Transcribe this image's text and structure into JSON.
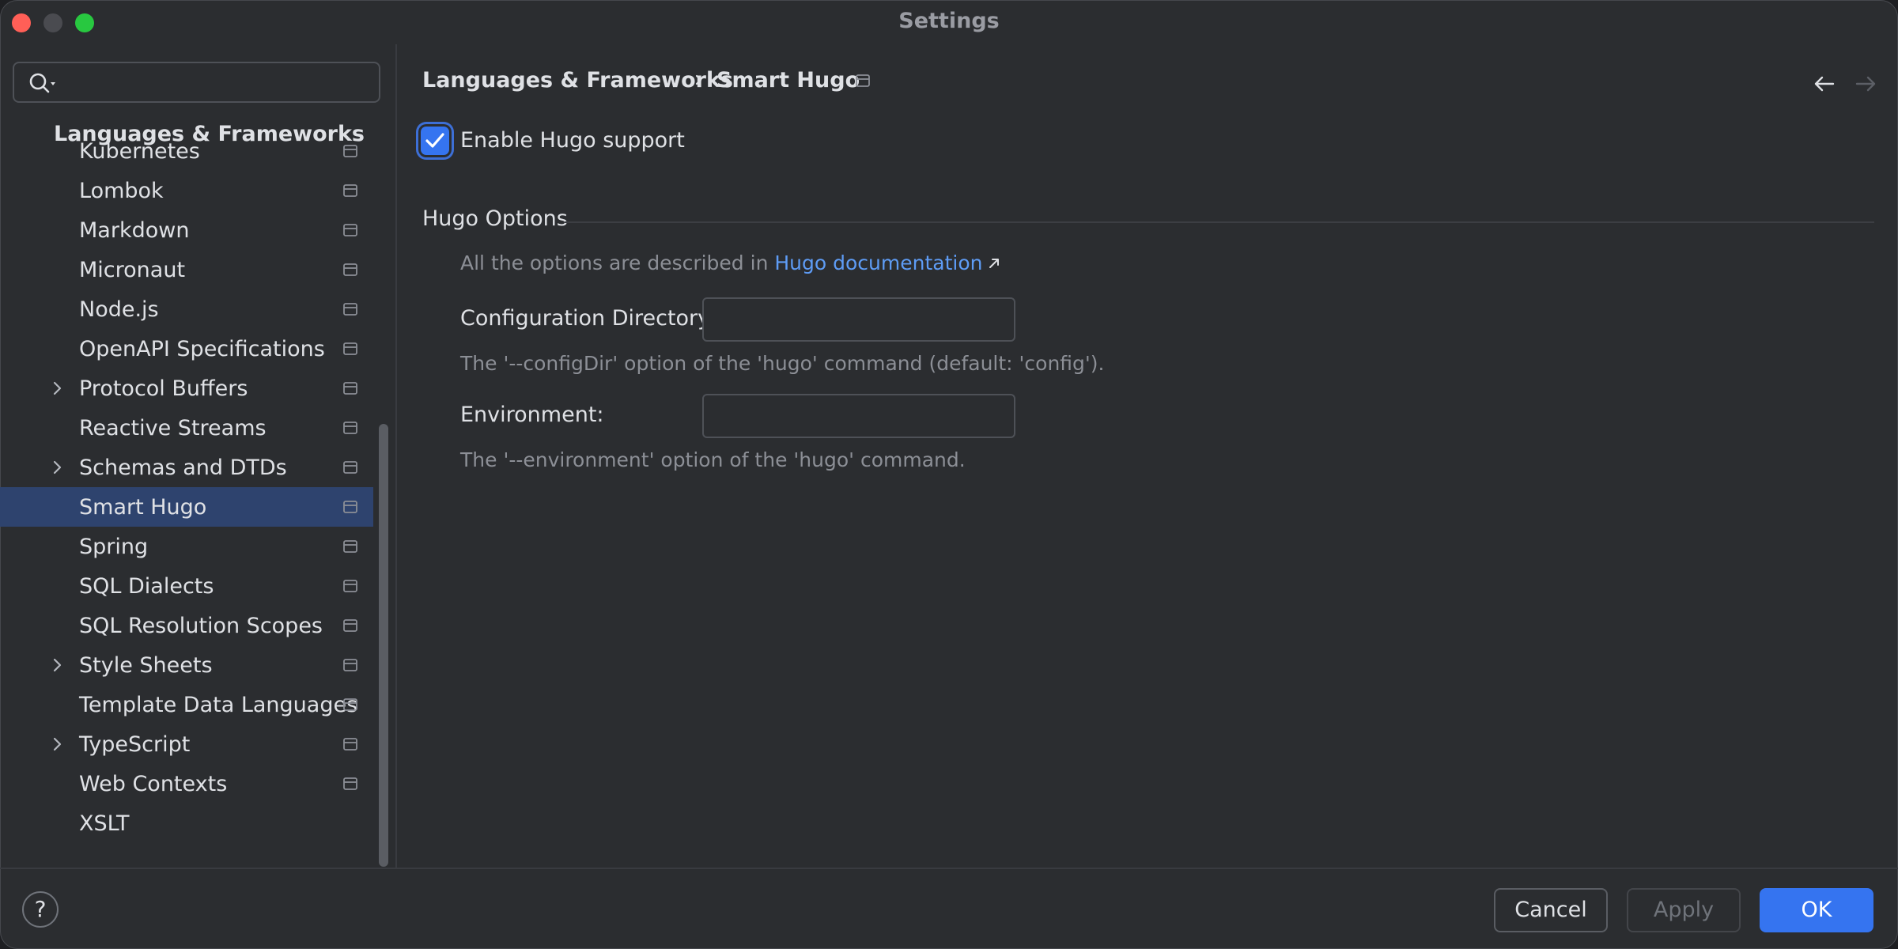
{
  "window": {
    "title": "Settings"
  },
  "search": {
    "placeholder": "",
    "value": ""
  },
  "sidebar": {
    "header": "Languages & Frameworks",
    "items": [
      {
        "label": "Kubernetes",
        "expandable": false,
        "project_icon": true
      },
      {
        "label": "Lombok",
        "expandable": false,
        "project_icon": true
      },
      {
        "label": "Markdown",
        "expandable": false,
        "project_icon": true
      },
      {
        "label": "Micronaut",
        "expandable": false,
        "project_icon": true
      },
      {
        "label": "Node.js",
        "expandable": false,
        "project_icon": true
      },
      {
        "label": "OpenAPI Specifications",
        "expandable": false,
        "project_icon": true
      },
      {
        "label": "Protocol Buffers",
        "expandable": true,
        "project_icon": true
      },
      {
        "label": "Reactive Streams",
        "expandable": false,
        "project_icon": true
      },
      {
        "label": "Schemas and DTDs",
        "expandable": true,
        "project_icon": true
      },
      {
        "label": "Smart Hugo",
        "expandable": false,
        "project_icon": true,
        "selected": true
      },
      {
        "label": "Spring",
        "expandable": false,
        "project_icon": true
      },
      {
        "label": "SQL Dialects",
        "expandable": false,
        "project_icon": true
      },
      {
        "label": "SQL Resolution Scopes",
        "expandable": false,
        "project_icon": true
      },
      {
        "label": "Style Sheets",
        "expandable": true,
        "project_icon": true
      },
      {
        "label": "Template Data Languages",
        "expandable": false,
        "project_icon": true
      },
      {
        "label": "TypeScript",
        "expandable": true,
        "project_icon": true
      },
      {
        "label": "Web Contexts",
        "expandable": false,
        "project_icon": true
      },
      {
        "label": "XSLT",
        "expandable": false,
        "project_icon": false
      }
    ]
  },
  "breadcrumb": {
    "parent": "Languages & Frameworks",
    "current": "Smart Hugo"
  },
  "content": {
    "enable_checkbox": {
      "label": "Enable Hugo support",
      "checked": true
    },
    "section_title": "Hugo Options",
    "description_prefix": "All the options are described in",
    "doc_link": "Hugo documentation",
    "fields": [
      {
        "label": "Configuration Directory:",
        "value": "",
        "hint": "The '--configDir' option of the 'hugo' command (default: 'config')."
      },
      {
        "label": "Environment:",
        "value": "",
        "hint": "The '--environment' option of the 'hugo' command."
      }
    ]
  },
  "footer": {
    "help": "?",
    "cancel": "Cancel",
    "apply": "Apply",
    "ok": "OK"
  },
  "colors": {
    "accent": "#3574f0",
    "link": "#5e9cf5",
    "selection": "#2e436e",
    "background": "#2b2d30"
  }
}
